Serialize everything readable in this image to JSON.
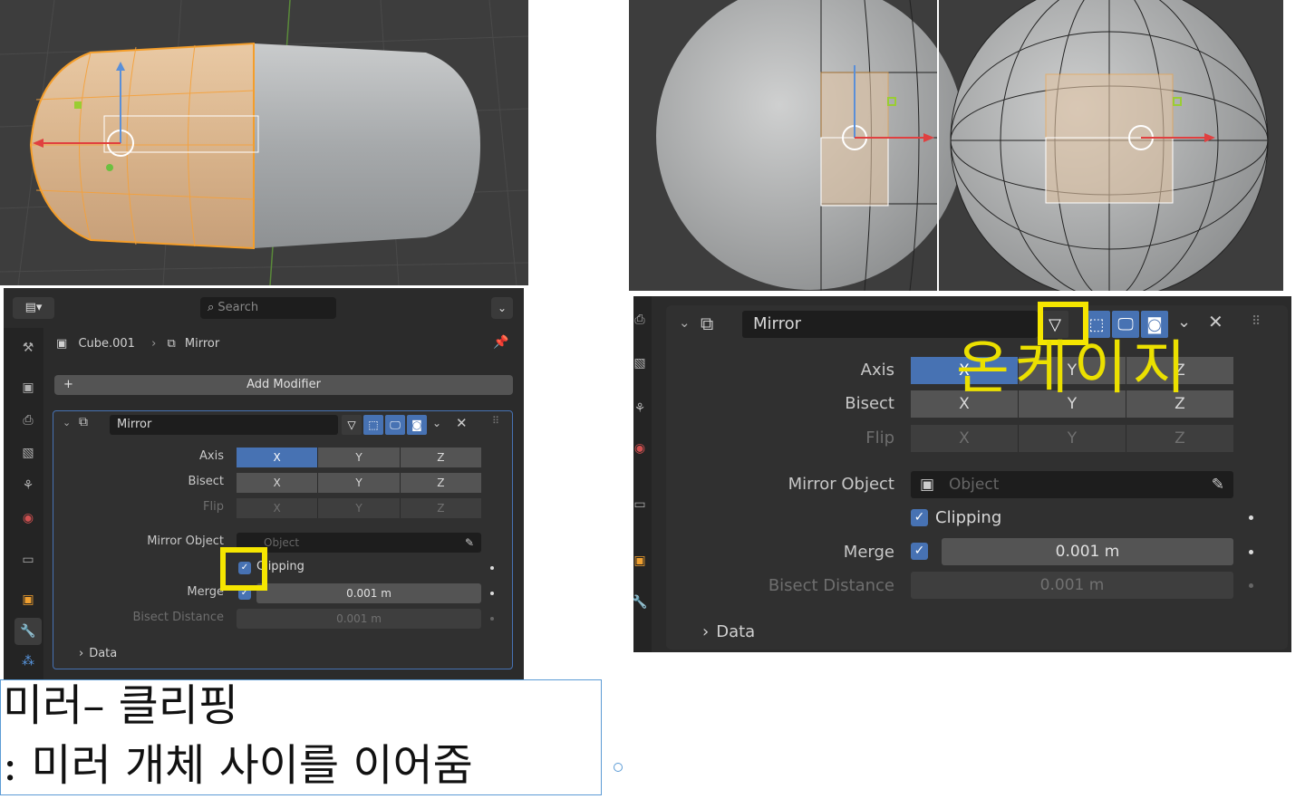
{
  "left_panel": {
    "search_placeholder": "Search",
    "breadcrumb_object": "Cube.001",
    "breadcrumb_modifier": "Mirror",
    "add_modifier": "Add Modifier",
    "modifier_name": "Mirror",
    "axis_label": "Axis",
    "bisect_label": "Bisect",
    "flip_label": "Flip",
    "x": "X",
    "y": "Y",
    "z": "Z",
    "mirror_object_label": "Mirror Object",
    "object_placeholder": "Object",
    "clipping_label": "Clipping",
    "merge_label": "Merge",
    "merge_value": "0.001 m",
    "bisect_distance_label": "Bisect Distance",
    "bisect_distance_value": "0.001 m",
    "data_label": "Data"
  },
  "right_panel": {
    "modifier_name": "Mirror",
    "axis_label": "Axis",
    "bisect_label": "Bisect",
    "flip_label": "Flip",
    "x": "X",
    "y": "Y",
    "z": "Z",
    "mirror_object_label": "Mirror Object",
    "object_placeholder": "Object",
    "clipping_label": "Clipping",
    "merge_label": "Merge",
    "merge_value": "0.001 m",
    "bisect_distance_label": "Bisect Distance",
    "bisect_distance_value": "0.001 m",
    "data_label": "Data"
  },
  "annotations": {
    "handwritten": "온케이지",
    "caption_line1": "미러– 클리핑",
    "caption_line2": ": 미러 개체 사이를 이어줌"
  },
  "colors": {
    "accent": "#4772b3",
    "highlight": "#f5e600",
    "selection": "#f5a623"
  }
}
